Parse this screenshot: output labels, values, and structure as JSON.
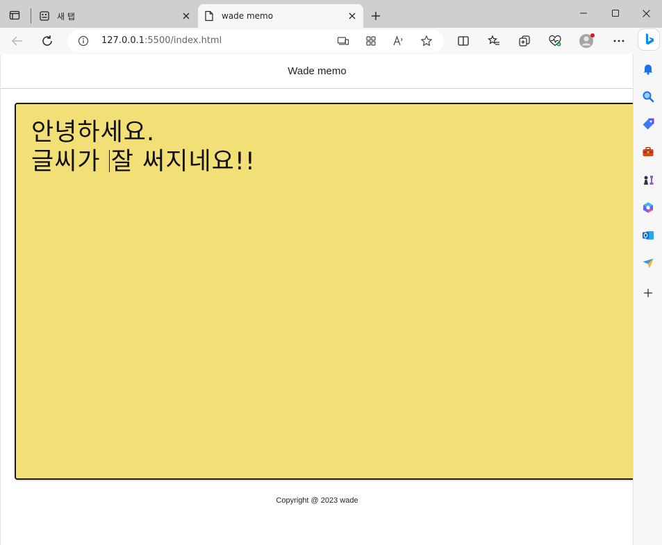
{
  "browser": {
    "tabs": [
      {
        "title": "새 탭",
        "active": false
      },
      {
        "title": "wade memo",
        "active": true
      }
    ],
    "address": {
      "host": "127.0.0.1",
      "rest": ":5500/index.html"
    }
  },
  "page": {
    "header_title": "Wade memo",
    "memo": {
      "line1": "안녕하세요.",
      "line2_before_caret": "글씨가 ",
      "line2_after_caret": "잘 써지네요!!"
    },
    "footer": "Copyright @ 2023 wade"
  },
  "colors": {
    "memo_background": "#f2e077",
    "memo_border": "#1a1a1a",
    "accent": "#0078d4"
  }
}
